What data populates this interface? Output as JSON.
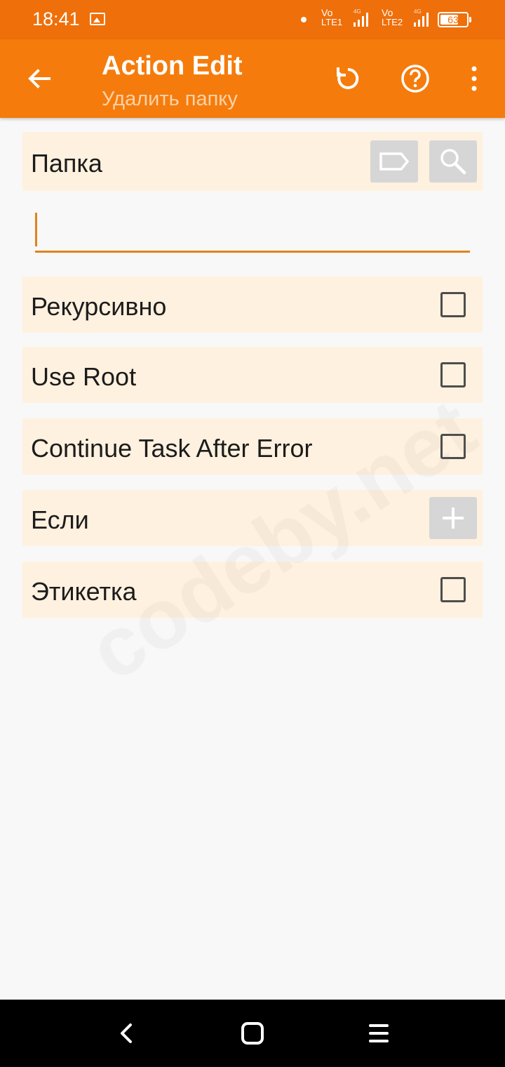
{
  "status_bar": {
    "time": "18:41",
    "sim1": {
      "vo": "Vo",
      "lte": "LTE1",
      "gen": "4G"
    },
    "sim2": {
      "vo": "Vo",
      "lte": "LTE2",
      "gen": "4G"
    },
    "battery_percent": "63",
    "icons": [
      "gallery-icon",
      "signal-icon",
      "battery-icon"
    ]
  },
  "app_bar": {
    "title": "Action Edit",
    "subtitle": "Удалить папку",
    "icons": [
      "back-arrow-icon",
      "reset-icon",
      "help-icon",
      "more-vert-icon"
    ]
  },
  "form": {
    "folder": {
      "label": "Папка",
      "value": "",
      "icons": [
        "tag-icon",
        "search-icon"
      ]
    },
    "options": [
      {
        "label": "Рекурсивно",
        "checked": false
      },
      {
        "label": "Use Root",
        "checked": false
      },
      {
        "label": "Continue Task After Error",
        "checked": false
      }
    ],
    "if_condition": {
      "label": "Если",
      "icon": "add-icon"
    },
    "label_option": {
      "label": "Этикетка",
      "checked": false
    }
  },
  "watermark": "codeby.net",
  "nav_bar": {
    "icons": [
      "nav-back-icon",
      "nav-home-icon",
      "nav-menu-icon"
    ]
  },
  "colors": {
    "status_bar": "#ef6f0a",
    "app_bar": "#f57c0c",
    "row_background": "#fff1df",
    "input_accent": "#e0831c",
    "background": "#f8f8f8"
  }
}
